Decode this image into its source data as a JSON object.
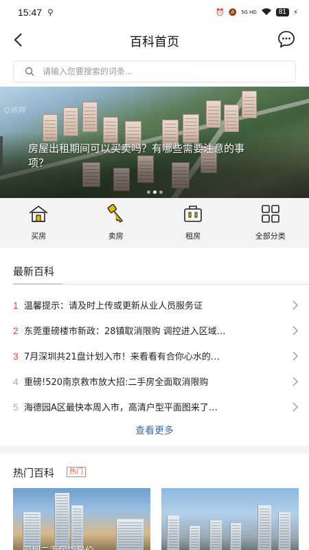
{
  "status": {
    "time": "15:47",
    "battery": "81",
    "network": "5G HD"
  },
  "header": {
    "title": "百科首页"
  },
  "search": {
    "placeholder": "请输入您要搜索的词条..."
  },
  "banner": {
    "title": "房屋出租期间可以买卖吗？有哪些需要注意的事项？",
    "watermark": "Q房网",
    "pages": 3,
    "active_page": 2
  },
  "categories": [
    {
      "label": "买房",
      "icon": "house-icon"
    },
    {
      "label": "卖房",
      "icon": "key-icon"
    },
    {
      "label": "租房",
      "icon": "briefcase-icon"
    },
    {
      "label": "全部分类",
      "icon": "grid-icon"
    }
  ],
  "latest": {
    "title": "最新百科",
    "items": [
      {
        "num": "1",
        "text": "温馨提示：请及时上传或更新从业人员服务证",
        "color": "#e0463a"
      },
      {
        "num": "2",
        "text": "东莞重磅楼市新政：28镇取消限购 调控进入区域…",
        "color": "#e0463a"
      },
      {
        "num": "3",
        "text": "7月深圳共21盘计划入市！来看看有合你心水的…",
        "color": "#e0463a"
      },
      {
        "num": "4",
        "text": "重磅!520南京救市放大招:二手房全面取消限购",
        "color": "#aaaaaa"
      },
      {
        "num": "5",
        "text": "海德园A区最快本周入市，高清户型平面图来了…",
        "color": "#aaaaaa"
      }
    ],
    "more_label": "查看更多"
  },
  "hot": {
    "title": "热门百科",
    "badge": "热门",
    "cards": [
      {
        "caption": "深圳二手房指导价"
      },
      {
        "caption": ""
      }
    ]
  },
  "colors": {
    "accent": "#3b6ea8",
    "rank_hot": "#e0463a",
    "rank_normal": "#aaaaaa"
  }
}
